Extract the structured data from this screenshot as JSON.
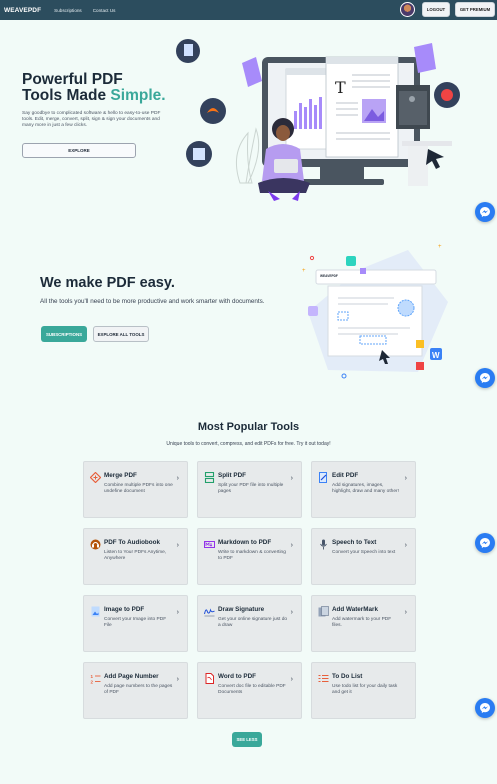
{
  "nav": {
    "brand": "WEAVEPDF",
    "links": [
      "Subscriptions",
      "Contact Us"
    ],
    "logout": "LOGOUT",
    "premium": "GET PREMIUM"
  },
  "hero": {
    "title_line1": "Powerful PDF",
    "title_line2_plain": "Tools Made ",
    "title_line2_accent": "Simple.",
    "description": "Say goodbye to complicated software & hello to easy-to-use PDF tools. Edit, merge, convert, split, sign & sign your documents and many more in just a few clicks.",
    "explore": "EXPLORE"
  },
  "promo": {
    "title": "We make PDF easy.",
    "description": "All the tools you'll need to be more productive and work smarter with documents.",
    "subscriptions": "SUBSCRIPTIONS",
    "explore_all": "EXPLORE ALL TOOLS"
  },
  "tools": {
    "title": "Most Popular Tools",
    "subtitle": "Unique tools to convert, compress, and edit PDFs for free. Try it out today!",
    "items": [
      {
        "title": "Merge PDF",
        "desc": "Combine multiple PDFs into one undefine document",
        "icon": "merge-icon"
      },
      {
        "title": "Split PDF",
        "desc": "Split your PDF file into multiple pages",
        "icon": "split-icon"
      },
      {
        "title": "Edit PDF",
        "desc": "Add signatures, images, highlight, draw and many other!",
        "icon": "edit-icon"
      },
      {
        "title": "PDF To Audiobook",
        "desc": "Listen to Your PDFs Anytime, Anywhere",
        "icon": "audiobook-icon"
      },
      {
        "title": "Markdown to PDF",
        "desc": "Write to markdown & converting to PDF",
        "icon": "markdown-icon"
      },
      {
        "title": "Speech to Text",
        "desc": "Convert your Speech into text",
        "icon": "microphone-icon"
      },
      {
        "title": "Image to PDF",
        "desc": "Convert your Image into PDF File",
        "icon": "image-icon"
      },
      {
        "title": "Draw Signature",
        "desc": "Get your online signature just do a draw",
        "icon": "signature-icon"
      },
      {
        "title": "Add WaterMark",
        "desc": "Add watermark to your PDF files.",
        "icon": "watermark-icon"
      },
      {
        "title": "Add Page Number",
        "desc": "Add page numbers to the pages of PDF",
        "icon": "page-number-icon"
      },
      {
        "title": "Word to PDF",
        "desc": "Convert doc file to editable PDF Documents",
        "icon": "word-icon"
      },
      {
        "title": "To Do List",
        "desc": "Use todo list for your daily task and get it",
        "icon": "todo-icon"
      }
    ],
    "see_less": "SEE LESS"
  },
  "art_text": {
    "editor_label": "WEAVEPDF",
    "doc_letter": "T",
    "word_letter": "W"
  },
  "colors": {
    "nav": "#2c4d5e",
    "accent": "#3aa89a",
    "background": "#f2fbf8",
    "messenger": "#2a7cf2",
    "illustration_purple": "#a78bfa"
  }
}
